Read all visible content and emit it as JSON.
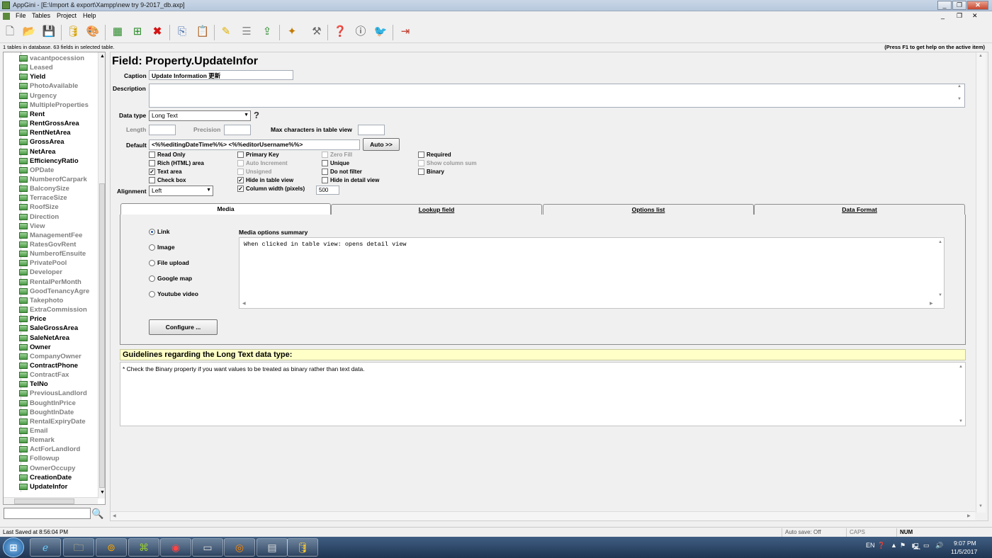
{
  "window": {
    "title": "AppGini - [E:\\Import & export\\Xampp\\new try 9-2017_db.axp]"
  },
  "menu": [
    "File",
    "Tables",
    "Project",
    "Help"
  ],
  "toolbar": {
    "icons": [
      "new-file-icon",
      "open-folder-icon",
      "save-icon",
      "database-icon",
      "palette-icon",
      "table-icon",
      "add-field-icon",
      "delete-icon",
      "copy-icon",
      "paste-icon",
      "highlight-icon",
      "list-icon",
      "upload-icon",
      "wand-icon",
      "tools-icon",
      "help-icon",
      "info-icon",
      "twitter-icon",
      "exit-icon"
    ]
  },
  "infobar": {
    "left": "1 tables in database. 63 fields in selected table.",
    "right": "(Press F1 to get help on the active item)"
  },
  "tree": {
    "items": [
      {
        "label": "vacantpocession",
        "dim": true
      },
      {
        "label": "Leased",
        "dim": true
      },
      {
        "label": "Yield",
        "dim": false
      },
      {
        "label": "PhotoAvailable",
        "dim": true
      },
      {
        "label": "Urgency",
        "dim": true
      },
      {
        "label": "MultipleProperties",
        "dim": true
      },
      {
        "label": "Rent",
        "dim": false
      },
      {
        "label": "RentGrossArea",
        "dim": false
      },
      {
        "label": "RentNetArea",
        "dim": false
      },
      {
        "label": "GrossArea",
        "dim": false
      },
      {
        "label": "NetArea",
        "dim": false
      },
      {
        "label": "EfficiencyRatio",
        "dim": false
      },
      {
        "label": "OPDate",
        "dim": true
      },
      {
        "label": "NumberofCarpark",
        "dim": true
      },
      {
        "label": "BalconySize",
        "dim": true
      },
      {
        "label": "TerraceSize",
        "dim": true
      },
      {
        "label": "RoofSize",
        "dim": true
      },
      {
        "label": "Direction",
        "dim": true
      },
      {
        "label": "View",
        "dim": true
      },
      {
        "label": "ManagementFee",
        "dim": true
      },
      {
        "label": "RatesGovRent",
        "dim": true
      },
      {
        "label": "NumberofEnsuite",
        "dim": true
      },
      {
        "label": "PrivatePool",
        "dim": true
      },
      {
        "label": "Developer",
        "dim": true
      },
      {
        "label": "RentalPerMonth",
        "dim": true
      },
      {
        "label": "GoodTenancyAgre",
        "dim": true
      },
      {
        "label": "Takephoto",
        "dim": true
      },
      {
        "label": "ExtraCommission",
        "dim": true
      },
      {
        "label": "Price",
        "dim": false
      },
      {
        "label": "SaleGrossArea",
        "dim": false
      },
      {
        "label": "SaleNetArea",
        "dim": false
      },
      {
        "label": "Owner",
        "dim": false
      },
      {
        "label": "CompanyOwner",
        "dim": true
      },
      {
        "label": "ContractPhone",
        "dim": false
      },
      {
        "label": "ContractFax",
        "dim": true
      },
      {
        "label": "TelNo",
        "dim": false
      },
      {
        "label": "PreviousLandlord",
        "dim": true
      },
      {
        "label": "BoughtInPrice",
        "dim": true
      },
      {
        "label": "BoughtInDate",
        "dim": true
      },
      {
        "label": "RentalExpiryDate",
        "dim": true
      },
      {
        "label": "Email",
        "dim": true
      },
      {
        "label": "Remark",
        "dim": true
      },
      {
        "label": "ActForLandlord",
        "dim": true
      },
      {
        "label": "Followup",
        "dim": true
      },
      {
        "label": "OwnerOccupy",
        "dim": true
      },
      {
        "label": "CreationDate",
        "dim": false
      },
      {
        "label": "UpdateInfor",
        "dim": false
      }
    ]
  },
  "search": {
    "value": ""
  },
  "field": {
    "heading": "Field: Property.UpdateInfor",
    "caption_label": "Caption",
    "caption_value": "Update Information 更新",
    "description_label": "Description",
    "description_value": "",
    "datatype_label": "Data type",
    "datatype_value": "Long Text",
    "help_mark": "?",
    "length_label": "Length",
    "length_value": "",
    "precision_label": "Precision",
    "precision_value": "",
    "maxchars_label": "Max characters in table view",
    "maxchars_value": "",
    "default_label": "Default",
    "default_value": "<%%editingDateTime%%> <%%editorUsername%%>",
    "auto_button": "Auto >>",
    "alignment_label": "Alignment",
    "alignment_value": "Left",
    "colwidth_value": "500"
  },
  "checkboxes": {
    "read_only": {
      "label": "Read Only",
      "checked": false
    },
    "rich_html": {
      "label": "Rich (HTML) area",
      "checked": false
    },
    "text_area": {
      "label": "Text area",
      "checked": true
    },
    "check_box": {
      "label": "Check box",
      "checked": false
    },
    "primary_key": {
      "label": "Primary Key",
      "checked": false
    },
    "auto_increment": {
      "label": "Auto Increment",
      "checked": false
    },
    "unsigned": {
      "label": "Unsigned",
      "checked": false
    },
    "hide_table": {
      "label": "Hide in table view",
      "checked": true
    },
    "column_width": {
      "label": "Column width (pixels)",
      "checked": true
    },
    "zero_fill": {
      "label": "Zero Fill",
      "checked": false
    },
    "unique": {
      "label": "Unique",
      "checked": false
    },
    "no_filter": {
      "label": "Do not filter",
      "checked": false
    },
    "hide_detail": {
      "label": "Hide in detail view",
      "checked": false
    },
    "required": {
      "label": "Required",
      "checked": false
    },
    "show_sum": {
      "label": "Show column sum",
      "checked": false
    },
    "binary": {
      "label": "Binary",
      "checked": false
    }
  },
  "tabs": [
    "Media",
    "Lookup field",
    "Options list",
    "Data Format"
  ],
  "media": {
    "options": [
      {
        "label": "Link",
        "selected": true
      },
      {
        "label": "Image",
        "selected": false
      },
      {
        "label": "File upload",
        "selected": false
      },
      {
        "label": "Google map",
        "selected": false
      },
      {
        "label": "Youtube video",
        "selected": false
      }
    ],
    "summary_label": "Media options summary",
    "summary_text": "When clicked in table view: opens detail view",
    "configure_button": "Configure ..."
  },
  "guidelines": {
    "title": "Guidelines regarding the Long Text data type:",
    "text": "* Check the Binary property if you want values to be treated as binary rather than text data."
  },
  "status": {
    "left": "Last Saved at 8:56:04 PM",
    "autosave": "Auto save: Off",
    "caps": "CAPS",
    "num": "NUM"
  },
  "taskbar": {
    "lang": "EN",
    "time": "9:07 PM",
    "date": "11/5/2017"
  }
}
